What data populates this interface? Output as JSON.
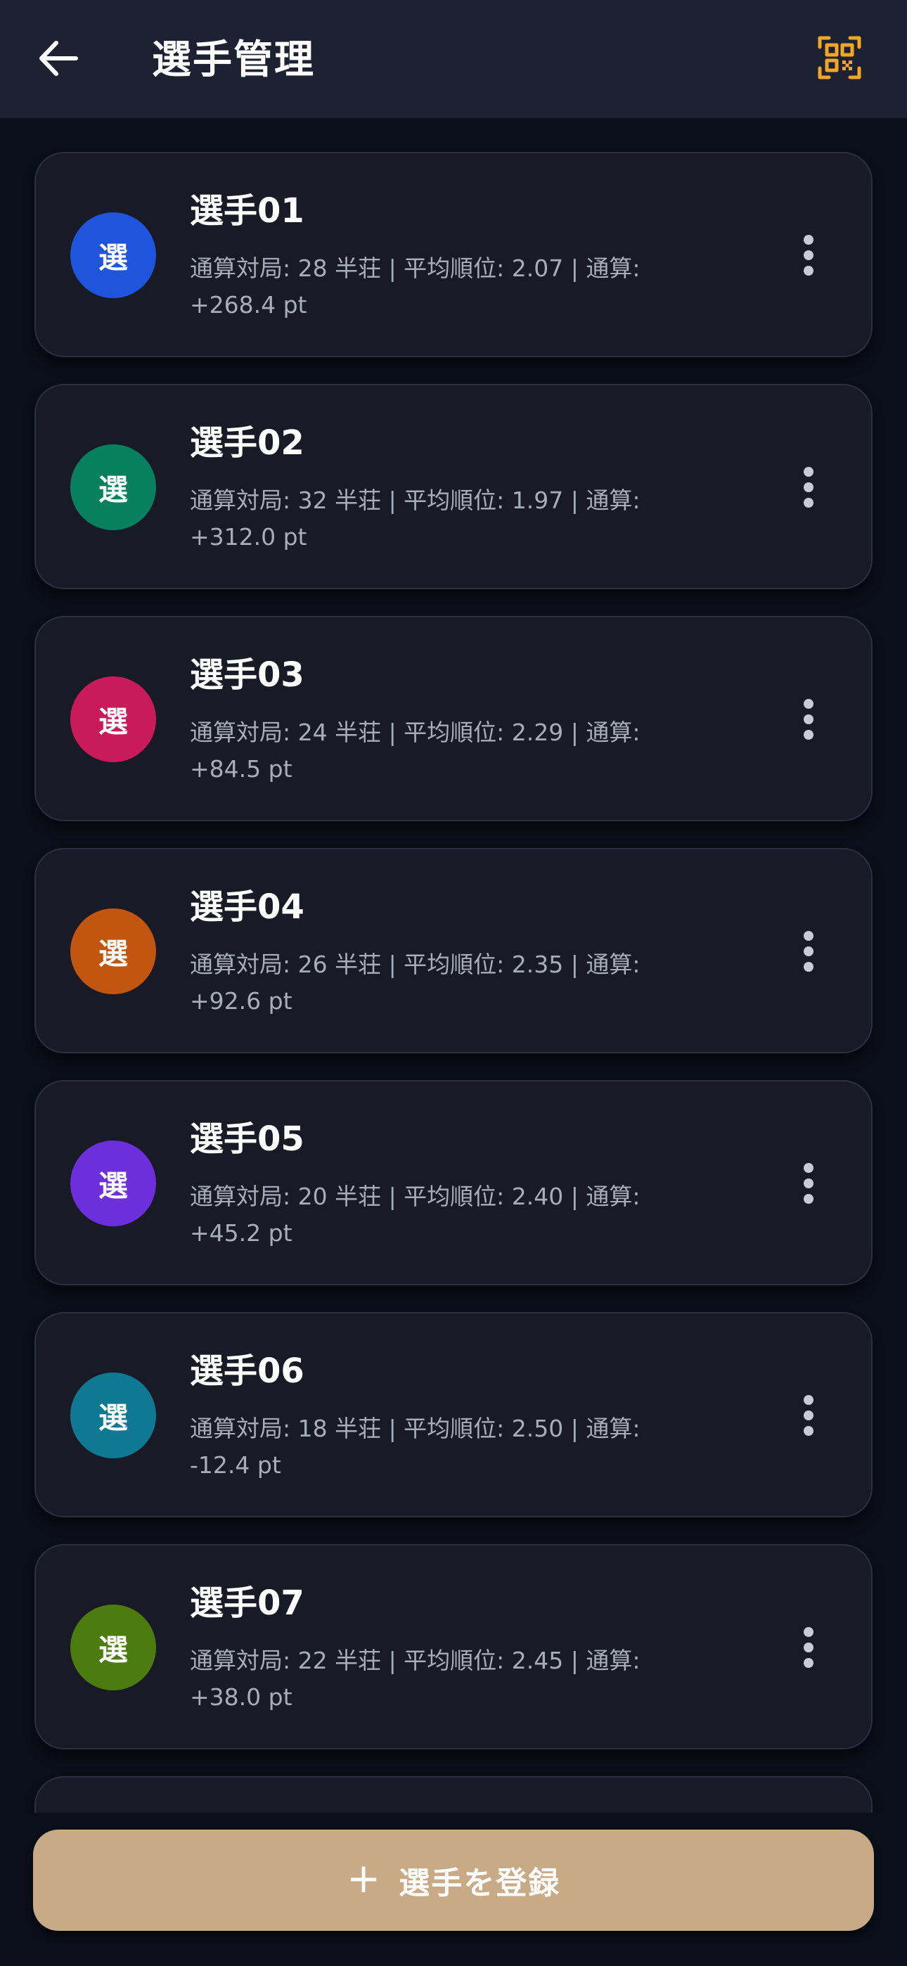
{
  "header": {
    "title": "選手管理",
    "back_icon": "arrow-left-icon",
    "qr_icon": "qr-code-icon",
    "accent_color": "#f2a628"
  },
  "players": [
    {
      "avatar_char": "選",
      "avatar_color": "#1f55dd",
      "name": "選手01",
      "stats_line1": "通算対局: 28 半荘 | 平均順位: 2.07 | 通算:",
      "stats_line2": "+268.4 pt"
    },
    {
      "avatar_char": "選",
      "avatar_color": "#07805f",
      "name": "選手02",
      "stats_line1": "通算対局: 32 半荘 | 平均順位: 1.97 | 通算:",
      "stats_line2": "+312.0 pt"
    },
    {
      "avatar_char": "選",
      "avatar_color": "#c91b5c",
      "name": "選手03",
      "stats_line1": "通算対局: 24 半荘 | 平均順位: 2.29 | 通算:",
      "stats_line2": "+84.5 pt"
    },
    {
      "avatar_char": "選",
      "avatar_color": "#c25510",
      "name": "選手04",
      "stats_line1": "通算対局: 26 半荘 | 平均順位: 2.35 | 通算:",
      "stats_line2": "+92.6 pt"
    },
    {
      "avatar_char": "選",
      "avatar_color": "#6d2fdc",
      "name": "選手05",
      "stats_line1": "通算対局: 20 半荘 | 平均順位: 2.40 | 通算:",
      "stats_line2": "+45.2 pt"
    },
    {
      "avatar_char": "選",
      "avatar_color": "#0f7892",
      "name": "選手06",
      "stats_line1": "通算対局: 18 半荘 | 平均順位: 2.50 | 通算:",
      "stats_line2": "-12.4 pt"
    },
    {
      "avatar_char": "選",
      "avatar_color": "#4c7b10",
      "name": "選手07",
      "stats_line1": "通算対局: 22 半荘 | 平均順位: 2.45 | 通算:",
      "stats_line2": "+38.0 pt"
    }
  ],
  "more_icon": "more-vertical-icon",
  "register_button": {
    "icon": "plus-icon",
    "plus_glyph": "+",
    "label": "選手を登録",
    "color": "#c8ab86"
  }
}
